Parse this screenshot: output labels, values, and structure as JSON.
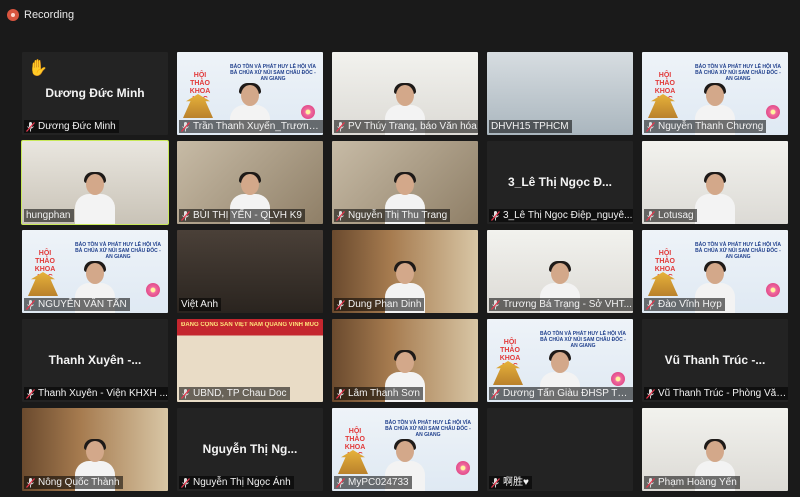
{
  "recording": {
    "label": "Recording",
    "color": "#d9553f"
  },
  "active_speaker_color": "#c8e85a",
  "slide": {
    "title": "HỘI THẢO KHOA HỌC",
    "subtitle": "BẢO TỒN VÀ PHÁT HUY LỄ HỘI VÍA BÀ CHÚA XỨ NÚI SAM CHÂU ĐỐC - AN GIANG"
  },
  "banner_text": "ĐẢNG CỘNG SẢN VIỆT NAM QUANG VINH MUÔN NĂM",
  "participants": [
    {
      "name": "Dương Đức Minh",
      "display": "Dương Đức Minh",
      "type": "name",
      "hand_raised": true,
      "muted": true
    },
    {
      "name": "Trần Thanh Xuyến_Trương Cao...",
      "type": "slide",
      "muted": true
    },
    {
      "name": "PV Thúy Trang, báo Văn hóa",
      "type": "white",
      "muted": true
    },
    {
      "name": "DHVH15 TPHCM",
      "type": "hall",
      "muted": false
    },
    {
      "name": "Nguyễn Thanh Chương",
      "type": "slide",
      "muted": true
    },
    {
      "name": "hungphan",
      "type": "office",
      "muted": false,
      "active": true
    },
    {
      "name": "BÙI THỊ YẾN - QLVH K9",
      "type": "room",
      "muted": true
    },
    {
      "name": "Nguyễn Thị Thu Trang",
      "type": "room",
      "muted": true
    },
    {
      "name": "3_Lê Thị Ngọc Điệp_nguyê...",
      "display": "3_Lê Thị Ngọc Đ...",
      "type": "name",
      "muted": true
    },
    {
      "name": "Lotusag",
      "type": "white",
      "muted": true
    },
    {
      "name": "NGUYỄN VĂN TẤN",
      "type": "slide",
      "muted": true
    },
    {
      "name": "Việt Anh",
      "type": "dark",
      "muted": false
    },
    {
      "name": "Dung Phan Dinh",
      "type": "library",
      "muted": true
    },
    {
      "name": "Trương Bá Trạng - Sở VHT...",
      "type": "white",
      "muted": true
    },
    {
      "name": "Đào Vĩnh Hợp",
      "type": "slide",
      "muted": true
    },
    {
      "name": "Thanh Xuyên - Viện KHXH ...",
      "display": "Thanh Xuyên -...",
      "type": "name",
      "muted": true
    },
    {
      "name": "UBND, TP Chau Doc",
      "type": "banner",
      "muted": true
    },
    {
      "name": "Lâm Thanh Sơn",
      "type": "library",
      "muted": true
    },
    {
      "name": "Dương Tấn Giàu ĐHSP TPH...",
      "type": "slide",
      "muted": true
    },
    {
      "name": "Vũ Thanh Trúc - Phòng Văn...",
      "display": "Vũ Thanh Trúc -...",
      "type": "name",
      "muted": true
    },
    {
      "name": "Nông Quốc Thành",
      "type": "library",
      "muted": true
    },
    {
      "name": "Nguyễn Thị Ngọc Ánh",
      "display": "Nguyễn Thị Ng...",
      "type": "name",
      "muted": true
    },
    {
      "name": "MyPC024733",
      "type": "slide",
      "muted": true
    },
    {
      "name": "啊胜♥",
      "display": "",
      "type": "name",
      "muted": true
    },
    {
      "name": "Phạm Hoàng Yến",
      "type": "white",
      "muted": true
    }
  ]
}
